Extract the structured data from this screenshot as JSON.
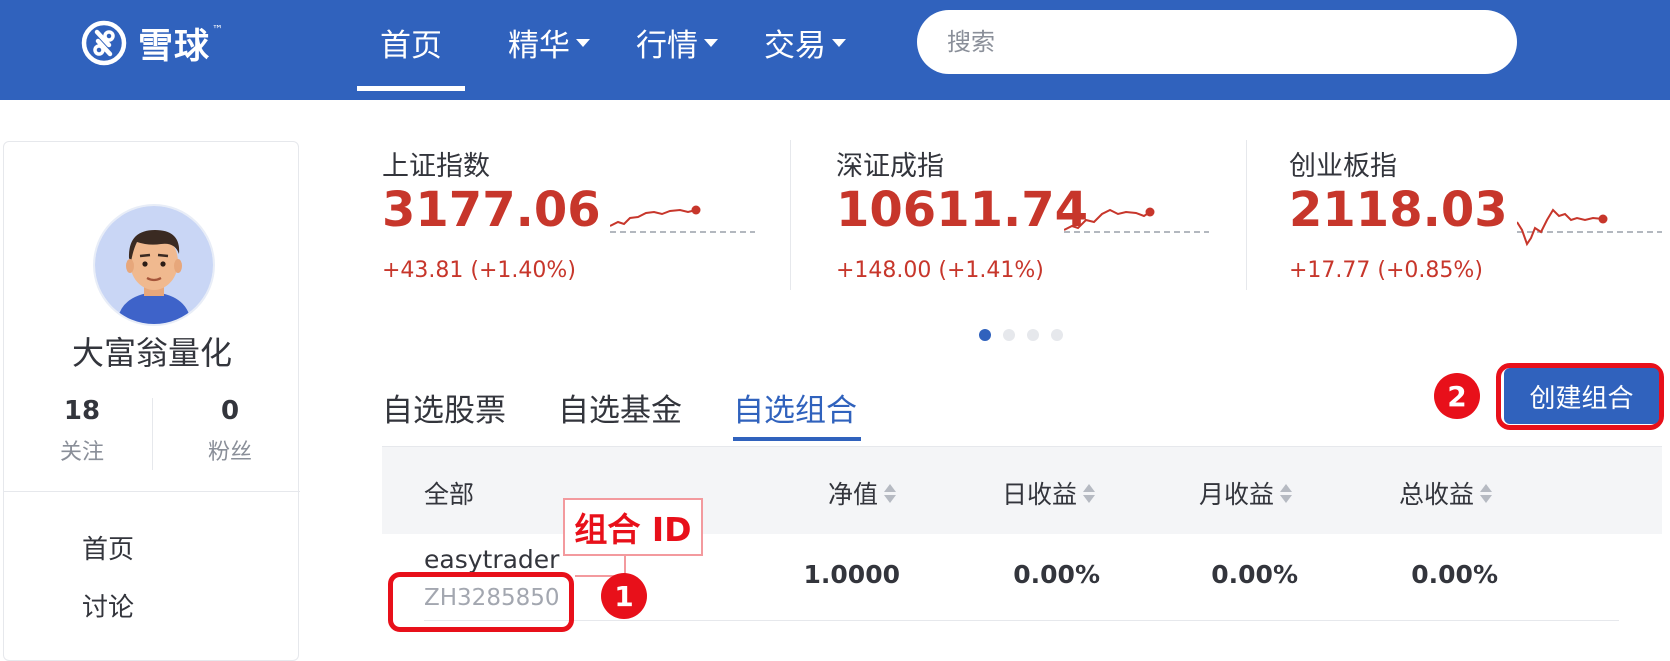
{
  "header": {
    "logo_text": "雪球",
    "logo_tm": "™",
    "nav": [
      {
        "label": "首页",
        "active": true,
        "has_caret": false
      },
      {
        "label": "精华",
        "has_caret": true
      },
      {
        "label": "行情",
        "has_caret": true
      },
      {
        "label": "交易",
        "has_caret": true
      }
    ],
    "search_placeholder": "搜索",
    "background_color": "#3062bd"
  },
  "profile": {
    "username": "大富翁量化",
    "following_count": "18",
    "following_label": "关注",
    "followers_count": "0",
    "followers_label": "粉丝",
    "links": [
      "首页",
      "讨论"
    ]
  },
  "indices": [
    {
      "name": "上证指数",
      "value": "3177.06",
      "change": "+43.81 (+1.40%)",
      "trend_icon": "sparkline-up"
    },
    {
      "name": "深证成指",
      "value": "10611.74",
      "change": "+148.00 (+1.41%)",
      "trend_icon": "sparkline-up"
    },
    {
      "name": "创业板指",
      "value": "2118.03",
      "change": "+17.77 (+0.85%)",
      "trend_icon": "sparkline-volatile-up"
    }
  ],
  "carousel": {
    "pages": 4,
    "active_index": 0
  },
  "tabs": [
    {
      "label": "自选股票",
      "active": false
    },
    {
      "label": "自选基金",
      "active": false
    },
    {
      "label": "自选组合",
      "active": true
    }
  ],
  "create_button_label": "创建组合",
  "table": {
    "columns": [
      "全部",
      "净值",
      "日收益",
      "月收益",
      "总收益"
    ],
    "rows": [
      {
        "name": "easytrader",
        "id": "ZH3285850",
        "nav": "1.0000",
        "daily": "0.00%",
        "monthly": "0.00%",
        "total": "0.00%"
      }
    ]
  },
  "annotations": {
    "badge_1": "1",
    "badge_2": "2",
    "id_callout": "组合 ID",
    "highlight_color": "#e8101a"
  },
  "colors": {
    "accent": "#3062bd",
    "up": "#c7362b"
  }
}
